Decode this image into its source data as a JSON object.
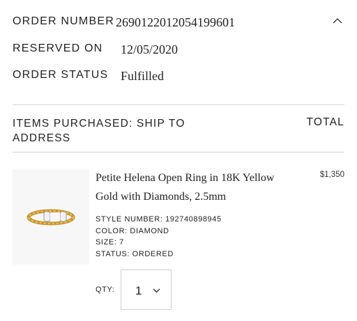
{
  "order": {
    "number_label": "ORDER NUMBER",
    "number_value": "2690122012054199601",
    "reserved_label": "RESERVED ON",
    "reserved_value": "12/05/2020",
    "status_label": "ORDER STATUS",
    "status_value": "Fulfilled",
    "toggle_icon": "chevron-up-icon"
  },
  "items": {
    "header_label": "ITEMS PURCHASED: SHIP TO ADDRESS",
    "total_label": "TOTAL",
    "list": [
      {
        "name": "Petite Helena Open Ring in 18K Yellow Gold with Diamonds, 2.5mm",
        "price": "$1,350",
        "style_number": "STYLE NUMBER: 192740898945",
        "color": "COLOR: DIAMOND",
        "size": "SIZE: 7",
        "status": "STATUS: ORDERED",
        "qty_label": "QTY:",
        "qty_value": "1",
        "image_icon": "ring-product-image"
      }
    ]
  }
}
